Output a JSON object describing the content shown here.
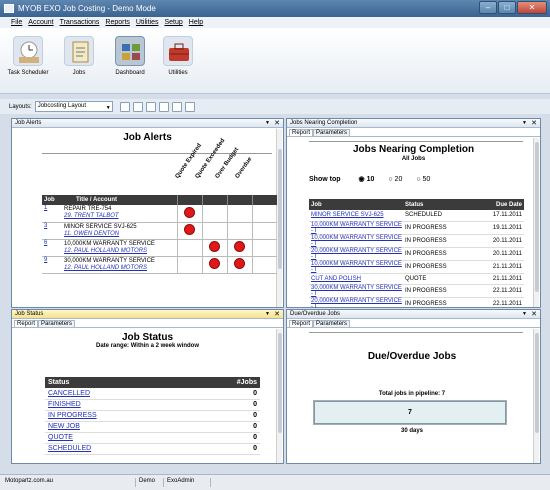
{
  "window": {
    "title": "MYOB EXO Job Costing - Demo Mode"
  },
  "menu": [
    "File",
    "Account",
    "Transactions",
    "Reports",
    "Utilities",
    "Setup",
    "Help"
  ],
  "ribbon": [
    {
      "label": "Task Scheduler"
    },
    {
      "label": "Jobs"
    },
    {
      "label": "Dashboard"
    },
    {
      "label": "Utilities"
    }
  ],
  "layouts": {
    "label": "Layouts:",
    "value": "Jobcosting Layout"
  },
  "job_alerts": {
    "panel_title": "Job Alerts",
    "heading": "Job Alerts",
    "col_job": "Job",
    "col_title": "Title / Account",
    "alert_cols": [
      "Quote Expired",
      "Quote Exceeded",
      "Over Budget",
      "Overdue"
    ],
    "rows": [
      {
        "job": "1",
        "title": "REPAIR TRE-754",
        "account": "29. TRENT TALBOT",
        "flags": [
          true,
          false,
          false,
          false
        ]
      },
      {
        "job": "3",
        "title": "MINOR SERVICE SVJ-625",
        "account": "11. OWEN DENTON",
        "flags": [
          true,
          false,
          false,
          false
        ]
      },
      {
        "job": "6",
        "title": "10,000KM WARRANTY SERVICE",
        "account": "12. PAUL HOLLAND MOTORS",
        "flags": [
          false,
          true,
          true,
          false
        ]
      },
      {
        "job": "9",
        "title": "30,000KM WARRANTY SERVICE",
        "account": "12. PAUL HOLLAND MOTORS",
        "flags": [
          false,
          true,
          true,
          false
        ]
      }
    ]
  },
  "jobs_nearing": {
    "panel_title": "Jobs Nearing Completion",
    "tabs": [
      "Report",
      "Parameters"
    ],
    "heading": "Jobs Nearing Completion",
    "subheading": "All Jobs",
    "show_top_label": "Show top",
    "options": [
      "10",
      "20",
      "50"
    ],
    "selected": "10",
    "cols": [
      "Job",
      "Status",
      "Due Date"
    ],
    "rows": [
      [
        "MINOR SERVICE SVJ-625",
        "SCHEDULED",
        "17.11.2011"
      ],
      [
        "10,000KM WARRANTY SERVICE - I",
        "IN PROGRESS",
        "19.11.2011"
      ],
      [
        "10,000KM WARRANTY SERVICE - I",
        "IN PROGRESS",
        "20.11.2011"
      ],
      [
        "20,000KM WARRANTY SERVICE - I",
        "IN PROGRESS",
        "20.11.2011"
      ],
      [
        "10,000KM WARRANTY SERVICE - I",
        "IN PROGRESS",
        "21.11.2011"
      ],
      [
        "CUT AND POLISH",
        "QUOTE",
        "21.11.2011"
      ],
      [
        "30,000KM WARRANTY SERVICE - I",
        "IN PROGRESS",
        "22.11.2011"
      ],
      [
        "20,000KM WARRANTY SERVICE - I",
        "IN PROGRESS",
        "22.11.2011"
      ]
    ]
  },
  "job_status": {
    "panel_title": "Job Status",
    "tabs": [
      "Report",
      "Parameters"
    ],
    "heading": "Job Status",
    "subheading": "Date range: Within a 2 week window",
    "cols": [
      "Status",
      "#Jobs"
    ],
    "rows": [
      [
        "CANCELLED",
        "0"
      ],
      [
        "FINISHED",
        "0"
      ],
      [
        "IN PROGRESS",
        "0"
      ],
      [
        "NEW JOB",
        "0"
      ],
      [
        "QUOTE",
        "0"
      ],
      [
        "SCHEDULED",
        "0"
      ]
    ]
  },
  "overdue": {
    "panel_title": "Due/Overdue Jobs",
    "tabs": [
      "Report",
      "Parameters"
    ],
    "heading": "Due/Overdue Jobs",
    "total_label": "Total jobs in pipeline: 7",
    "bar_value": "7",
    "bar_fraction": 1,
    "days_label": "30 days"
  },
  "statusbar": [
    "Motopartz.com.au",
    "Demo",
    "ExoAdmin"
  ],
  "colors": {
    "alert_dot": "#e01818",
    "link": "#2330b8",
    "header": "#3b3b3b"
  }
}
